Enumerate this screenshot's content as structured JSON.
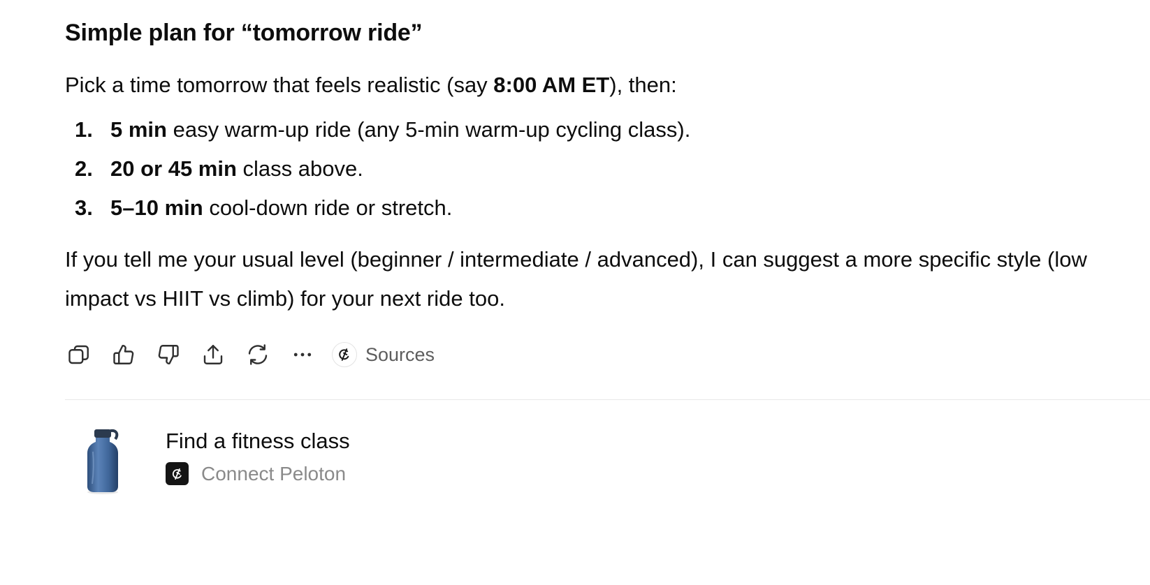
{
  "message": {
    "title": "Simple plan for “tomorrow ride”",
    "intro": {
      "before": "Pick a time tomorrow that feels realistic (say ",
      "bold": "8:00 AM ET",
      "after": "), then:"
    },
    "steps": [
      {
        "num": "1.",
        "bold": "5 min",
        "text": " easy warm-up ride (any 5-min warm-up cycling class)."
      },
      {
        "num": "2.",
        "bold": "20 or 45 min",
        "text": " class above."
      },
      {
        "num": "3.",
        "bold": "5–10 min",
        "text": " cool-down ride or stretch."
      }
    ],
    "outro": "If you tell me your usual level (beginner / intermediate / advanced), I can suggest a more specific style (low impact vs HIIT vs climb) for your next ride too."
  },
  "actions": {
    "icons": [
      "copy-icon",
      "thumbs-up-icon",
      "thumbs-down-icon",
      "share-icon",
      "regenerate-icon",
      "more-icon",
      "peloton-icon"
    ],
    "sources_label": "Sources"
  },
  "card": {
    "title": "Find a fitness class",
    "subtitle": "Connect Peloton",
    "image": "water-bottle-icon"
  },
  "colors": {
    "text": "#0d0d0d",
    "muted": "#8a8a8a",
    "icon": "#2f2f2f",
    "divider": "#e8e8e8"
  }
}
